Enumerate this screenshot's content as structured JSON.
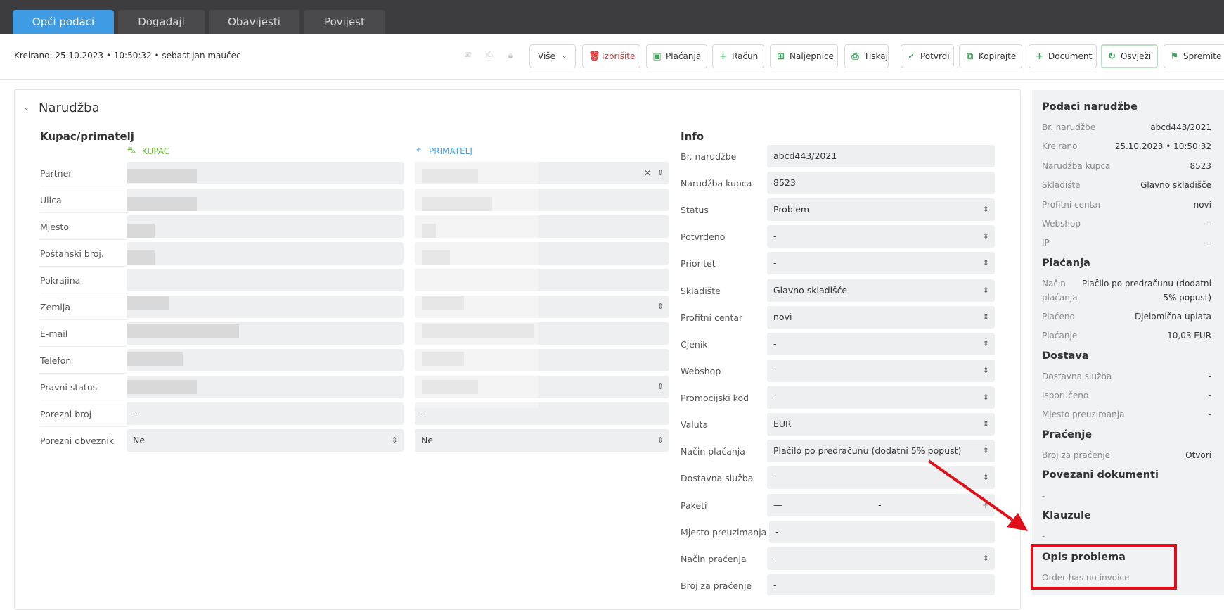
{
  "tabs": [
    "Opći podaci",
    "Događaji",
    "Obavijesti",
    "Povijest"
  ],
  "toolbar": {
    "created": "Kreirano: 25.10.2023 • 10:50:32 • sebastijan maučec",
    "more": "Više",
    "buttons": [
      "Izbrišite",
      "Plaćanja",
      "Račun",
      "Naljepnice",
      "Tiskaj",
      "Potvrdi",
      "Kopirajte",
      "Document",
      "Osvježi",
      "Spremite"
    ]
  },
  "section": {
    "title": "Narudžba",
    "customer_title": "Kupac/primatelj",
    "buyer_label": "KUPAC",
    "recipient_label": "PRIMATELJ",
    "rows": [
      "Partner",
      "Ulica",
      "Mjesto",
      "Poštanski broj.",
      "Pokrajina",
      "Zemlja",
      "E-mail",
      "Telefon",
      "Pravni status",
      "Porezni broj",
      "Porezni obveznik"
    ],
    "tax_no_buyer": "-",
    "tax_no_recipient": "-",
    "taxpayer_buyer": "Ne",
    "taxpayer_recipient": "Ne"
  },
  "info": {
    "title": "Info",
    "rows": [
      {
        "label": "Br. narudžbe",
        "value": "abcd443/2021"
      },
      {
        "label": "Narudžba kupca",
        "value": "8523"
      },
      {
        "label": "Status",
        "value": "Problem"
      },
      {
        "label": "Potvrđeno",
        "value": "-"
      },
      {
        "label": "Prioritet",
        "value": "-"
      },
      {
        "label": "Skladište",
        "value": "Glavno skladišče"
      },
      {
        "label": "Profitni centar",
        "value": "novi"
      },
      {
        "label": "Cjenik",
        "value": "-"
      },
      {
        "label": "Webshop",
        "value": "-"
      },
      {
        "label": "Promocijski kod",
        "value": "-"
      },
      {
        "label": "Valuta",
        "value": "EUR"
      },
      {
        "label": "Način plaćanja",
        "value": "Plačilo po predračunu (dodatni 5% popust)"
      },
      {
        "label": "Dostavna služba",
        "value": "-"
      },
      {
        "label": "Paketi",
        "value": "-"
      },
      {
        "label": "Mjesto preuzimanja",
        "value": "-"
      },
      {
        "label": "Način praćenja",
        "value": "-"
      },
      {
        "label": "Broj za praćenje",
        "value": "-"
      }
    ]
  },
  "sidebar": {
    "order_title": "Podaci narudžbe",
    "order_rows": [
      {
        "label": "Br. narudžbe",
        "value": "abcd443/2021"
      },
      {
        "label": "Kreirano",
        "value": "25.10.2023 • 10:50:32"
      },
      {
        "label": "Narudžba kupca",
        "value": "8523"
      },
      {
        "label": "Skladište",
        "value": "Glavno skladišče"
      },
      {
        "label": "Profitni centar",
        "value": "novi"
      },
      {
        "label": "Webshop",
        "value": "-"
      },
      {
        "label": "IP",
        "value": "-"
      }
    ],
    "payment_title": "Plaćanja",
    "payment_method_label1": "Način",
    "payment_method_label2": "plaćanja",
    "payment_method_value1": "Plačilo po predračunu (dodatni",
    "payment_method_value2": "5% popust)",
    "paid_label": "Plaćeno",
    "paid_value": "Djelomična uplata",
    "payment_label": "Plaćanje",
    "payment_value": "10,03 EUR",
    "delivery_title": "Dostava",
    "delivery_rows": [
      {
        "label": "Dostavna služba",
        "value": "-"
      },
      {
        "label": "Isporučeno",
        "value": "-"
      },
      {
        "label": "Mjesto preuzimanja",
        "value": "-"
      }
    ],
    "tracking_title": "Praćenje",
    "tracking_label": "Broj za praćenje",
    "tracking_link": "Otvori",
    "linked_title": "Povezani dokumenti",
    "linked_value": "-",
    "clauses_title": "Klauzule",
    "clauses_value": "-",
    "problem_title": "Opis problema",
    "problem_text": "Order has no invoice"
  },
  "colors": {
    "accent": "#3f9be4",
    "highlight": "#e0101a",
    "buyer": "#6bb33d",
    "delete": "#e23a3a"
  }
}
